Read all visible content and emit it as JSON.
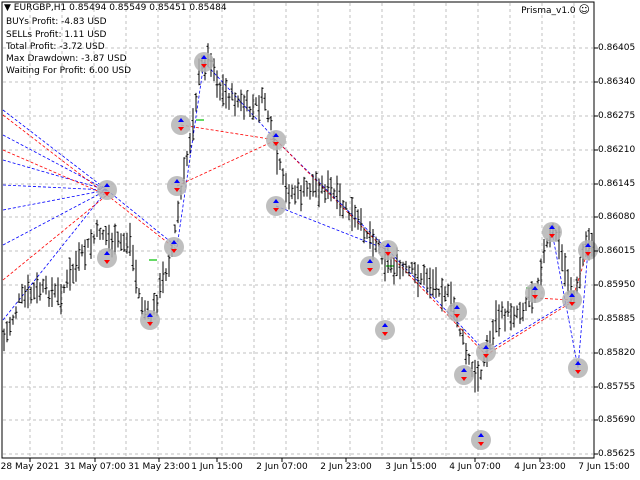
{
  "window": {
    "symbol_line": "EURGBP,H1  0.85494 0.85549 0.85451 0.85484",
    "indicator_name": "Prisma_v1.0",
    "smiley_icon": "smiley-icon"
  },
  "info_panel": [
    "BUYs Profit: -4.83 USD",
    "SELLs Profit: 1.11 USD",
    "Total Profit: -3.72 USD",
    "Max Drawdown: -3.87 USD",
    "Waiting For Profit: 6.00 USD"
  ],
  "price_axis": [
    "0.86405",
    "0.86340",
    "0.86275",
    "0.86210",
    "0.86145",
    "0.86080",
    "0.86015",
    "0.85950",
    "0.85885",
    "0.85820",
    "0.85755",
    "0.85690",
    "0.85625"
  ],
  "time_axis": [
    "28 May 2021",
    "31 May 07:00",
    "31 May 23:00",
    "1 Jun 15:00",
    "2 Jun 07:00",
    "2 Jun 23:00",
    "3 Jun 15:00",
    "4 Jun 07:00",
    "4 Jun 23:00",
    "7 Jun 15:00"
  ],
  "colors": {
    "background": "#ffffff",
    "grid": "#c0c0c0",
    "bars": "#000000",
    "buy_marker": "#0000ff",
    "sell_marker": "#ff0000",
    "marker_halo": "#b4b4b4",
    "pending": "#00c000"
  }
}
